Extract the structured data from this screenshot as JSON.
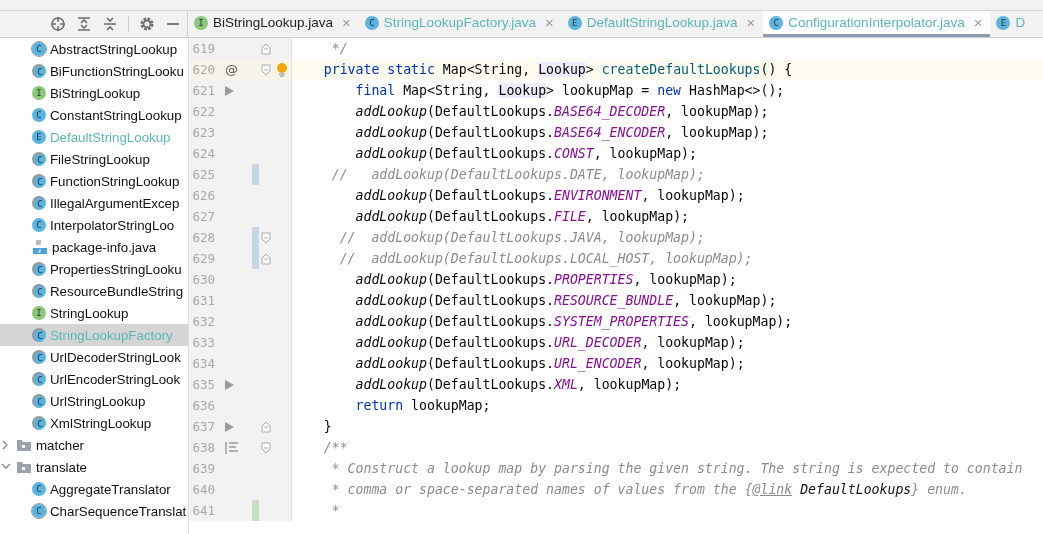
{
  "sidebar_toolbar": [
    {
      "kind": "locate"
    },
    {
      "kind": "expand"
    },
    {
      "kind": "collapse"
    },
    {
      "kind": "gear"
    },
    {
      "kind": "minimize"
    }
  ],
  "tabs": [
    {
      "label": "BiStringLookup.java",
      "kind": "interface",
      "letter": "I",
      "highlighted": false,
      "selected": false,
      "close": "×"
    },
    {
      "label": "StringLookupFactory.java",
      "kind": "class",
      "letter": "C",
      "highlighted": true,
      "selected": false,
      "close": "×"
    },
    {
      "label": "DefaultStringLookup.java",
      "kind": "enum",
      "letter": "E",
      "highlighted": true,
      "selected": false,
      "close": "×"
    },
    {
      "label": "ConfigurationInterpolator.java",
      "kind": "class",
      "letter": "C",
      "highlighted": true,
      "selected": true,
      "close": "×"
    },
    {
      "label": "D",
      "kind": "enum",
      "letter": "E",
      "highlighted": true,
      "selected": false
    }
  ],
  "tree": [
    {
      "label": "AbstractStringLookup",
      "kind": "abstract",
      "letter": "C",
      "overlay": false,
      "highlighted": false,
      "selected": false
    },
    {
      "label": "BiFunctionStringLooku",
      "kind": "class",
      "letter": "C",
      "overlay": true,
      "highlighted": false,
      "selected": false
    },
    {
      "label": "BiStringLookup",
      "kind": "interface",
      "letter": "I",
      "overlay": false,
      "highlighted": false,
      "selected": false
    },
    {
      "label": "ConstantStringLookup",
      "kind": "class",
      "letter": "C",
      "overlay": false,
      "highlighted": false,
      "selected": false
    },
    {
      "label": "DefaultStringLookup",
      "kind": "enum",
      "letter": "E",
      "overlay": false,
      "highlighted": true,
      "selected": false
    },
    {
      "label": "FileStringLookup",
      "kind": "class",
      "letter": "C",
      "overlay": true,
      "highlighted": false,
      "selected": false
    },
    {
      "label": "FunctionStringLookup",
      "kind": "class",
      "letter": "C",
      "overlay": true,
      "highlighted": false,
      "selected": false
    },
    {
      "label": "IllegalArgumentExcep",
      "kind": "class",
      "letter": "C",
      "overlay": true,
      "highlighted": false,
      "selected": false
    },
    {
      "label": "InterpolatorStringLoo",
      "kind": "class",
      "letter": "C",
      "overlay": false,
      "highlighted": false,
      "selected": false
    },
    {
      "label": "package-info.java",
      "kind": "file",
      "highlighted": false,
      "selected": false
    },
    {
      "label": "PropertiesStringLooku",
      "kind": "class",
      "letter": "C",
      "overlay": true,
      "highlighted": false,
      "selected": false
    },
    {
      "label": "ResourceBundleString",
      "kind": "class",
      "letter": "C",
      "overlay": true,
      "highlighted": false,
      "selected": false
    },
    {
      "label": "StringLookup",
      "kind": "interface",
      "letter": "I",
      "overlay": false,
      "highlighted": false,
      "selected": false
    },
    {
      "label": "StringLookupFactory",
      "kind": "class",
      "letter": "C",
      "overlay": true,
      "highlighted": true,
      "selected": true
    },
    {
      "label": "UrlDecoderStringLook",
      "kind": "class",
      "letter": "C",
      "overlay": true,
      "highlighted": false,
      "selected": false
    },
    {
      "label": "UrlEncoderStringLook",
      "kind": "class",
      "letter": "C",
      "overlay": true,
      "highlighted": false,
      "selected": false
    },
    {
      "label": "UrlStringLookup",
      "kind": "class",
      "letter": "C",
      "overlay": true,
      "highlighted": false,
      "selected": false
    },
    {
      "label": "XmlStringLookup",
      "kind": "class",
      "letter": "C",
      "overlay": true,
      "highlighted": false,
      "selected": false
    },
    {
      "label": "matcher",
      "kind": "folder",
      "expanded": false,
      "highlighted": false,
      "selected": false
    },
    {
      "label": "translate",
      "kind": "folder",
      "expanded": true,
      "highlighted": false,
      "selected": false,
      "children": [
        {
          "label": "AggregateTranslator",
          "kind": "class",
          "letter": "C",
          "overlay": false,
          "highlighted": false,
          "selected": false
        },
        {
          "label": "CharSequenceTranslat",
          "kind": "abstract",
          "letter": "C",
          "overlay": false,
          "highlighted": false,
          "selected": false
        }
      ]
    }
  ],
  "editor": {
    "lines": [
      {
        "number": "619",
        "fold_end": true,
        "tokens": [
          {
            "kind": "doc",
            "text": "     */"
          }
        ]
      },
      {
        "number": "620",
        "current": true,
        "fold_start": true,
        "annotation": "@",
        "bulb": true,
        "tokens": [
          {
            "kind": "kw",
            "text": "    private static "
          },
          {
            "kind": "t",
            "text": "Map<String, "
          },
          {
            "kind": "ref",
            "text": "Lookup"
          },
          {
            "kind": "t",
            "text": "> "
          },
          {
            "kind": "fn",
            "text": "createDefaultLookups"
          },
          {
            "kind": "t",
            "text": "() {"
          }
        ]
      },
      {
        "number": "621",
        "arrow": true,
        "tokens": [
          {
            "kind": "kw",
            "text": "        final "
          },
          {
            "kind": "t",
            "text": "Map<String, "
          },
          {
            "kind": "ref",
            "text": "Lookup"
          },
          {
            "kind": "t",
            "text": "> lookupMap = "
          },
          {
            "kind": "kw",
            "text": "new "
          },
          {
            "kind": "t",
            "text": "HashMap<>();"
          }
        ]
      },
      {
        "number": "622",
        "tokens": [
          {
            "kind": "call",
            "text": "        addLookup"
          },
          {
            "kind": "t",
            "text": "(DefaultLookups."
          },
          {
            "kind": "const",
            "text": "BASE64_DECODER"
          },
          {
            "kind": "t",
            "text": ", lookupMap);"
          }
        ]
      },
      {
        "number": "623",
        "tokens": [
          {
            "kind": "call",
            "text": "        addLookup"
          },
          {
            "kind": "t",
            "text": "(DefaultLookups."
          },
          {
            "kind": "const",
            "text": "BASE64_ENCODER"
          },
          {
            "kind": "t",
            "text": ", lookupMap);"
          }
        ]
      },
      {
        "number": "624",
        "tokens": [
          {
            "kind": "call",
            "text": "        addLookup"
          },
          {
            "kind": "t",
            "text": "(DefaultLookups."
          },
          {
            "kind": "const",
            "text": "CONST"
          },
          {
            "kind": "t",
            "text": ", lookupMap);"
          }
        ]
      },
      {
        "number": "625",
        "changed": true,
        "tokens": [
          {
            "kind": "cm",
            "text": "     //   addLookup(DefaultLookups.DATE, lookupMap);"
          }
        ]
      },
      {
        "number": "626",
        "tokens": [
          {
            "kind": "call",
            "text": "        addLookup"
          },
          {
            "kind": "t",
            "text": "(DefaultLookups."
          },
          {
            "kind": "const",
            "text": "ENVIRONMENT"
          },
          {
            "kind": "t",
            "text": ", lookupMap);"
          }
        ]
      },
      {
        "number": "627",
        "tokens": [
          {
            "kind": "call",
            "text": "        addLookup"
          },
          {
            "kind": "t",
            "text": "(DefaultLookups."
          },
          {
            "kind": "const",
            "text": "FILE"
          },
          {
            "kind": "t",
            "text": ", lookupMap);"
          }
        ]
      },
      {
        "number": "628",
        "changed": true,
        "fold_start": true,
        "tokens": [
          {
            "kind": "cm",
            "text": "      //  addLookup(DefaultLookups.JAVA, lookupMap);"
          }
        ]
      },
      {
        "number": "629",
        "changed": true,
        "fold_end": true,
        "tokens": [
          {
            "kind": "cm",
            "text": "      //  addLookup(DefaultLookups.LOCAL_HOST, lookupMap);"
          }
        ]
      },
      {
        "number": "630",
        "tokens": [
          {
            "kind": "call",
            "text": "        addLookup"
          },
          {
            "kind": "t",
            "text": "(DefaultLookups."
          },
          {
            "kind": "const",
            "text": "PROPERTIES"
          },
          {
            "kind": "t",
            "text": ", lookupMap);"
          }
        ]
      },
      {
        "number": "631",
        "tokens": [
          {
            "kind": "call",
            "text": "        addLookup"
          },
          {
            "kind": "t",
            "text": "(DefaultLookups."
          },
          {
            "kind": "const",
            "text": "RESOURCE_BUNDLE"
          },
          {
            "kind": "t",
            "text": ", lookupMap);"
          }
        ]
      },
      {
        "number": "632",
        "tokens": [
          {
            "kind": "call",
            "text": "        addLookup"
          },
          {
            "kind": "t",
            "text": "(DefaultLookups."
          },
          {
            "kind": "const",
            "text": "SYSTEM_PROPERTIES"
          },
          {
            "kind": "t",
            "text": ", lookupMap);"
          }
        ]
      },
      {
        "number": "633",
        "tokens": [
          {
            "kind": "call",
            "text": "        addLookup"
          },
          {
            "kind": "t",
            "text": "(DefaultLookups."
          },
          {
            "kind": "const",
            "text": "URL_DECODER"
          },
          {
            "kind": "t",
            "text": ", lookupMap);"
          }
        ]
      },
      {
        "number": "634",
        "tokens": [
          {
            "kind": "call",
            "text": "        addLookup"
          },
          {
            "kind": "t",
            "text": "(DefaultLookups."
          },
          {
            "kind": "const",
            "text": "URL_ENCODER"
          },
          {
            "kind": "t",
            "text": ", lookupMap);"
          }
        ]
      },
      {
        "number": "635",
        "arrow": true,
        "tokens": [
          {
            "kind": "call",
            "text": "        addLookup"
          },
          {
            "kind": "t",
            "text": "(DefaultLookups."
          },
          {
            "kind": "const",
            "text": "XML"
          },
          {
            "kind": "t",
            "text": ", lookupMap);"
          }
        ]
      },
      {
        "number": "636",
        "tokens": [
          {
            "kind": "kw",
            "text": "        return "
          },
          {
            "kind": "t",
            "text": "lookupMap;"
          }
        ]
      },
      {
        "number": "637",
        "fold_end": true,
        "arrow": true,
        "tokens": [
          {
            "kind": "t",
            "text": "    }"
          }
        ]
      },
      {
        "number": "638",
        "fold_start": true,
        "doc_toggle": true,
        "tokens": [
          {
            "kind": "doc",
            "text": "    /**"
          }
        ]
      },
      {
        "number": "639",
        "tokens": [
          {
            "kind": "doc",
            "text": "     * Construct a lookup map by parsing the given string. The string is expected to contain"
          }
        ]
      },
      {
        "number": "640",
        "tokens": [
          {
            "kind": "doc",
            "text": "     * comma or space-separated names of values from the {"
          },
          {
            "kind": "doclink",
            "text": "@link"
          },
          {
            "kind": "docref",
            "text": " DefaultLookups"
          },
          {
            "kind": "doc",
            "text": "} enum."
          }
        ]
      },
      {
        "number": "641",
        "added": true,
        "tokens": [
          {
            "kind": "doc",
            "text": "     *"
          }
        ]
      }
    ]
  }
}
